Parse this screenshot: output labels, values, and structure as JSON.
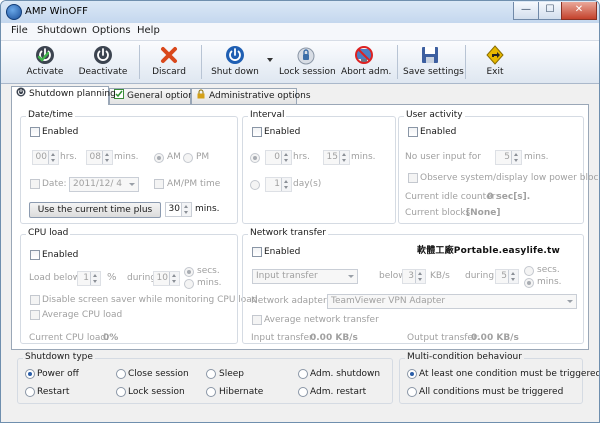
{
  "window": {
    "title": "AMP WinOFF",
    "minimize_glyph": "—",
    "maximize_glyph": "☐",
    "close_glyph": "✕"
  },
  "menu": [
    "File",
    "Shutdown",
    "Options",
    "Help"
  ],
  "toolbar": [
    {
      "label": "Activate",
      "icon": "power-check-icon"
    },
    {
      "label": "Deactivate",
      "icon": "power-icon"
    },
    {
      "label": "Discard",
      "icon": "x-icon"
    },
    {
      "label": "Shut down",
      "icon": "shutdown-icon"
    },
    {
      "label": "Lock session",
      "icon": "lock-icon"
    },
    {
      "label": "Abort adm.",
      "icon": "abort-icon"
    },
    {
      "label": "Save settings",
      "icon": "save-icon"
    },
    {
      "label": "Exit",
      "icon": "exit-icon"
    }
  ],
  "tabs": [
    {
      "label": "Shutdown planning",
      "icon": "power-icon"
    },
    {
      "label": "General options",
      "icon": "checklist-icon"
    },
    {
      "label": "Administrative options",
      "icon": "lock-icon"
    }
  ],
  "datetime": {
    "title": "Date/time",
    "enabled_label": "Enabled",
    "hours_value": "00",
    "hours_unit": "hrs.",
    "minutes_value": "08",
    "minutes_unit": "mins.",
    "am_label": "AM",
    "pm_label": "PM",
    "date_label": "Date:",
    "date_value": "2011/12/  4",
    "ampm_time_label": "AM/PM time",
    "use_current_button": "Use the current time plus",
    "plus_minutes_value": "30",
    "plus_minutes_unit": "mins."
  },
  "interval": {
    "title": "Interval",
    "enabled_label": "Enabled",
    "hours_value": "0",
    "hours_unit": "hrs.",
    "minutes_value": "15",
    "minutes_unit": "mins.",
    "days_value": "1",
    "days_unit": "day(s)"
  },
  "user_activity": {
    "title": "User activity",
    "enabled_label": "Enabled",
    "no_input_label": "No user input for",
    "no_input_value": "5",
    "no_input_unit": "mins.",
    "observe_label": "Observe system/display low power blocks",
    "idle_counter_label": "Current idle counter:",
    "idle_counter_value": "0 sec[s].",
    "blocks_label": "Current blocks:",
    "blocks_value": "[None]"
  },
  "cpu": {
    "title": "CPU load",
    "enabled_label": "Enabled",
    "load_below_label": "Load below",
    "load_value": "1",
    "load_unit": "%",
    "during_label": "during",
    "during_value": "10",
    "secs_label": "secs.",
    "mins_label": "mins.",
    "disable_saver_label": "Disable screen saver while monitoring CPU load",
    "average_label": "Average CPU load",
    "current_label": "Current CPU load:",
    "current_value": "0%"
  },
  "network": {
    "title": "Network transfer",
    "enabled_label": "Enabled",
    "transfer_type": "Input transfer",
    "below_label": "below",
    "below_value": "3",
    "below_unit": "KB/s",
    "during_label": "during",
    "during_value": "5",
    "secs_label": "secs.",
    "mins_label": "mins.",
    "adapter_label": "Network adapter:",
    "adapter_value": "TeamViewer VPN Adapter",
    "average_label": "Average network transfer",
    "input_label": "Input transfer:",
    "input_value": "0.00 KB/s",
    "output_label": "Output transfer:",
    "output_value": "0.00 KB/s"
  },
  "watermark": "軟體工廠Portable.easylife.tw",
  "shutdown_type": {
    "title": "Shutdown type",
    "options": [
      "Power off",
      "Close session",
      "Sleep",
      "Adm. shutdown",
      "Restart",
      "Lock session",
      "Hibernate",
      "Adm. restart"
    ]
  },
  "multi_condition": {
    "title": "Multi-condition behaviour",
    "options": [
      "At least one condition must be triggered",
      "All conditions must be triggered"
    ]
  },
  "colors": {
    "accent": "#2b5ea8",
    "titlebar": "#c4d7ee",
    "discard_red": "#d9481c",
    "exit_yellow": "#e6b800"
  }
}
